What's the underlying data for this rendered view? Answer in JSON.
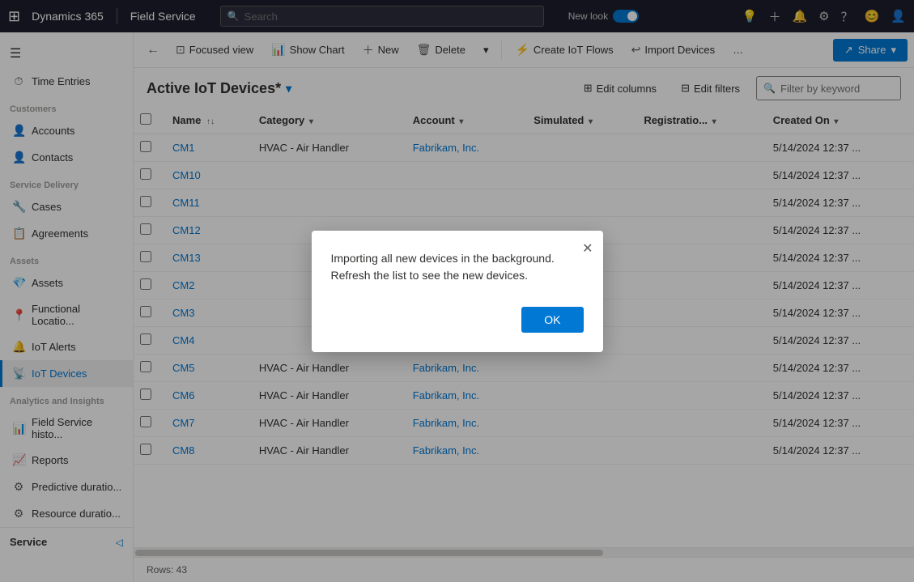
{
  "topnav": {
    "waffle": "⊞",
    "app_name": "Dynamics 365",
    "module_name": "Field Service",
    "search_placeholder": "Search",
    "new_look_label": "New look",
    "icons": [
      "lightbulb",
      "plus",
      "bell",
      "gear",
      "question",
      "smiley",
      "user"
    ]
  },
  "sidebar": {
    "hamburger": "☰",
    "time_entries_label": "Time Entries",
    "sections": [
      {
        "title": "Customers",
        "items": [
          {
            "id": "accounts",
            "label": "Accounts",
            "icon": "👤"
          },
          {
            "id": "contacts",
            "label": "Contacts",
            "icon": "👤"
          }
        ]
      },
      {
        "title": "Service Delivery",
        "items": [
          {
            "id": "cases",
            "label": "Cases",
            "icon": "🔧"
          },
          {
            "id": "agreements",
            "label": "Agreements",
            "icon": "📋"
          }
        ]
      },
      {
        "title": "Assets",
        "items": [
          {
            "id": "assets",
            "label": "Assets",
            "icon": "💎"
          },
          {
            "id": "functional-location",
            "label": "Functional Locatio...",
            "icon": "📍"
          },
          {
            "id": "iot-alerts",
            "label": "IoT Alerts",
            "icon": "🔔"
          },
          {
            "id": "iot-devices",
            "label": "IoT Devices",
            "icon": "📡"
          }
        ]
      },
      {
        "title": "Analytics and Insights",
        "items": [
          {
            "id": "field-service-histo",
            "label": "Field Service histo...",
            "icon": "📊"
          },
          {
            "id": "reports",
            "label": "Reports",
            "icon": "📈"
          },
          {
            "id": "predictive-duratio",
            "label": "Predictive duratio...",
            "icon": "⚙"
          },
          {
            "id": "resource-duratio",
            "label": "Resource duratio...",
            "icon": "⚙"
          }
        ]
      }
    ],
    "bottom_item": "Service"
  },
  "toolbar": {
    "back_icon": "←",
    "focused_view_label": "Focused view",
    "show_chart_label": "Show Chart",
    "new_label": "New",
    "delete_label": "Delete",
    "create_iot_flows_label": "Create IoT Flows",
    "import_devices_label": "Import Devices",
    "more_icon": "…",
    "share_label": "Share"
  },
  "list": {
    "title": "Active IoT Devices*",
    "edit_columns_label": "Edit columns",
    "edit_filters_label": "Edit filters",
    "filter_placeholder": "Filter by keyword",
    "columns": [
      {
        "id": "name",
        "label": "Name",
        "sortable": true
      },
      {
        "id": "category",
        "label": "Category",
        "filterable": true
      },
      {
        "id": "account",
        "label": "Account",
        "filterable": true
      },
      {
        "id": "simulated",
        "label": "Simulated",
        "filterable": true
      },
      {
        "id": "registration",
        "label": "Registratio...",
        "filterable": true
      },
      {
        "id": "created_on",
        "label": "Created On",
        "filterable": true
      }
    ],
    "rows": [
      {
        "name": "CM1",
        "category": "HVAC - Air Handler",
        "account": "Fabrikam, Inc.",
        "simulated": "",
        "registration": "",
        "created_on": "5/14/2024 12:37 ..."
      },
      {
        "name": "CM10",
        "category": "",
        "account": "",
        "simulated": "",
        "registration": "",
        "created_on": "5/14/2024 12:37 ..."
      },
      {
        "name": "CM11",
        "category": "",
        "account": "",
        "simulated": "",
        "registration": "",
        "created_on": "5/14/2024 12:37 ..."
      },
      {
        "name": "CM12",
        "category": "",
        "account": "",
        "simulated": "",
        "registration": "",
        "created_on": "5/14/2024 12:37 ..."
      },
      {
        "name": "CM13",
        "category": "",
        "account": "",
        "simulated": "",
        "registration": "",
        "created_on": "5/14/2024 12:37 ..."
      },
      {
        "name": "CM2",
        "category": "",
        "account": "",
        "simulated": "",
        "registration": "",
        "created_on": "5/14/2024 12:37 ..."
      },
      {
        "name": "CM3",
        "category": "",
        "account": "",
        "simulated": "",
        "registration": "",
        "created_on": "5/14/2024 12:37 ..."
      },
      {
        "name": "CM4",
        "category": "",
        "account": "",
        "simulated": "",
        "registration": "",
        "created_on": "5/14/2024 12:37 ..."
      },
      {
        "name": "CM5",
        "category": "HVAC - Air Handler",
        "account": "Fabrikam, Inc.",
        "simulated": "",
        "registration": "",
        "created_on": "5/14/2024 12:37 ..."
      },
      {
        "name": "CM6",
        "category": "HVAC - Air Handler",
        "account": "Fabrikam, Inc.",
        "simulated": "",
        "registration": "",
        "created_on": "5/14/2024 12:37 ..."
      },
      {
        "name": "CM7",
        "category": "HVAC - Air Handler",
        "account": "Fabrikam, Inc.",
        "simulated": "",
        "registration": "",
        "created_on": "5/14/2024 12:37 ..."
      },
      {
        "name": "CM8",
        "category": "HVAC - Air Handler",
        "account": "Fabrikam, Inc.",
        "simulated": "",
        "registration": "",
        "created_on": "5/14/2024 12:37 ..."
      }
    ],
    "row_count": "Rows: 43"
  },
  "modal": {
    "message": "Importing all new devices in the background. Refresh the list to see the new devices.",
    "ok_label": "OK",
    "close_icon": "✕"
  }
}
